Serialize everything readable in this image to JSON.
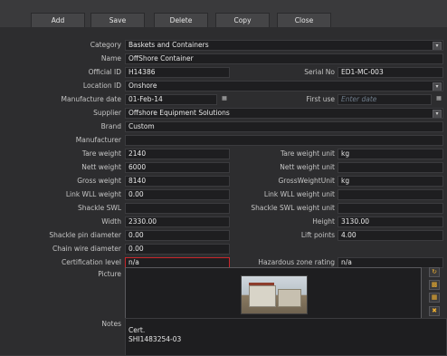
{
  "toolbar": {
    "add": "Add",
    "save": "Save",
    "delete": "Delete",
    "copy": "Copy",
    "close": "Close"
  },
  "fields": {
    "category_label": "Category",
    "category_value": "Baskets and Containers",
    "name_label": "Name",
    "name_value": "OffShore Container",
    "official_id_label": "Official ID",
    "official_id_value": "H14386",
    "serial_no_label": "Serial No",
    "serial_no_value": "ED1-MC-003",
    "location_id_label": "Location ID",
    "location_id_value": "Onshore",
    "manufacture_date_label": "Manufacture date",
    "manufacture_date_value": "01-Feb-14",
    "first_use_label": "First use",
    "first_use_placeholder": "Enter date",
    "supplier_label": "Supplier",
    "supplier_value": "Offshore Equipment Solutions",
    "brand_label": "Brand",
    "brand_value": "Custom",
    "manufacturer_label": "Manufacturer",
    "manufacturer_value": "",
    "tare_weight_label": "Tare weight",
    "tare_weight_value": "2140",
    "tare_weight_unit_label": "Tare weight unit",
    "tare_weight_unit_value": "kg",
    "nett_weight_label": "Nett weight",
    "nett_weight_value": "6000",
    "nett_weight_unit_label": "Nett weight unit",
    "nett_weight_unit_value": "",
    "gross_weight_label": "Gross weight",
    "gross_weight_value": "8140",
    "gross_weight_unit_label": "GrossWeightUnit",
    "gross_weight_unit_value": "kg",
    "link_wll_weight_label": "Link WLL weight",
    "link_wll_weight_value": "0.00",
    "link_wll_weight_unit_label": "Link WLL weight unit",
    "link_wll_weight_unit_value": "",
    "shackle_swl_label": "Shackle SWL",
    "shackle_swl_value": "",
    "shackle_swl_weight_unit_label": "Shackle SWL weight unit",
    "shackle_swl_weight_unit_value": "",
    "width_label": "Width",
    "width_value": "2330.00",
    "height_label": "Height",
    "height_value": "3130.00",
    "shackle_pin_diameter_label": "Shackle pin diameter",
    "shackle_pin_diameter_value": "0.00",
    "lift_points_label": "Lift points",
    "lift_points_value": "4.00",
    "chain_wire_diameter_label": "Chain wire diameter",
    "chain_wire_diameter_value": "0.00",
    "certification_level_label": "Certification level",
    "certification_level_value": "n/a",
    "hazardous_zone_rating_label": "Hazardous zone rating",
    "hazardous_zone_rating_value": "n/a",
    "picture_label": "Picture",
    "notes_label": "Notes",
    "notes_line1": "Cert.",
    "notes_line2": "SHI1483254-03"
  },
  "icons": {
    "dropdown": "chevron-down-icon",
    "calendar": "calendar-icon",
    "picture_add": "folder-icon",
    "picture_tools": [
      "rotate-icon",
      "lock-icon",
      "folder-open-icon",
      "delete-icon"
    ]
  },
  "colors": {
    "background": "#2d2d2f",
    "toolbar": "#3a3a3c",
    "field": "#1e1e20",
    "field_border": "#3b3b3e",
    "highlight_border": "#c8262b",
    "placeholder": "#6e7c8a",
    "icon_accent": "#f0b030"
  }
}
